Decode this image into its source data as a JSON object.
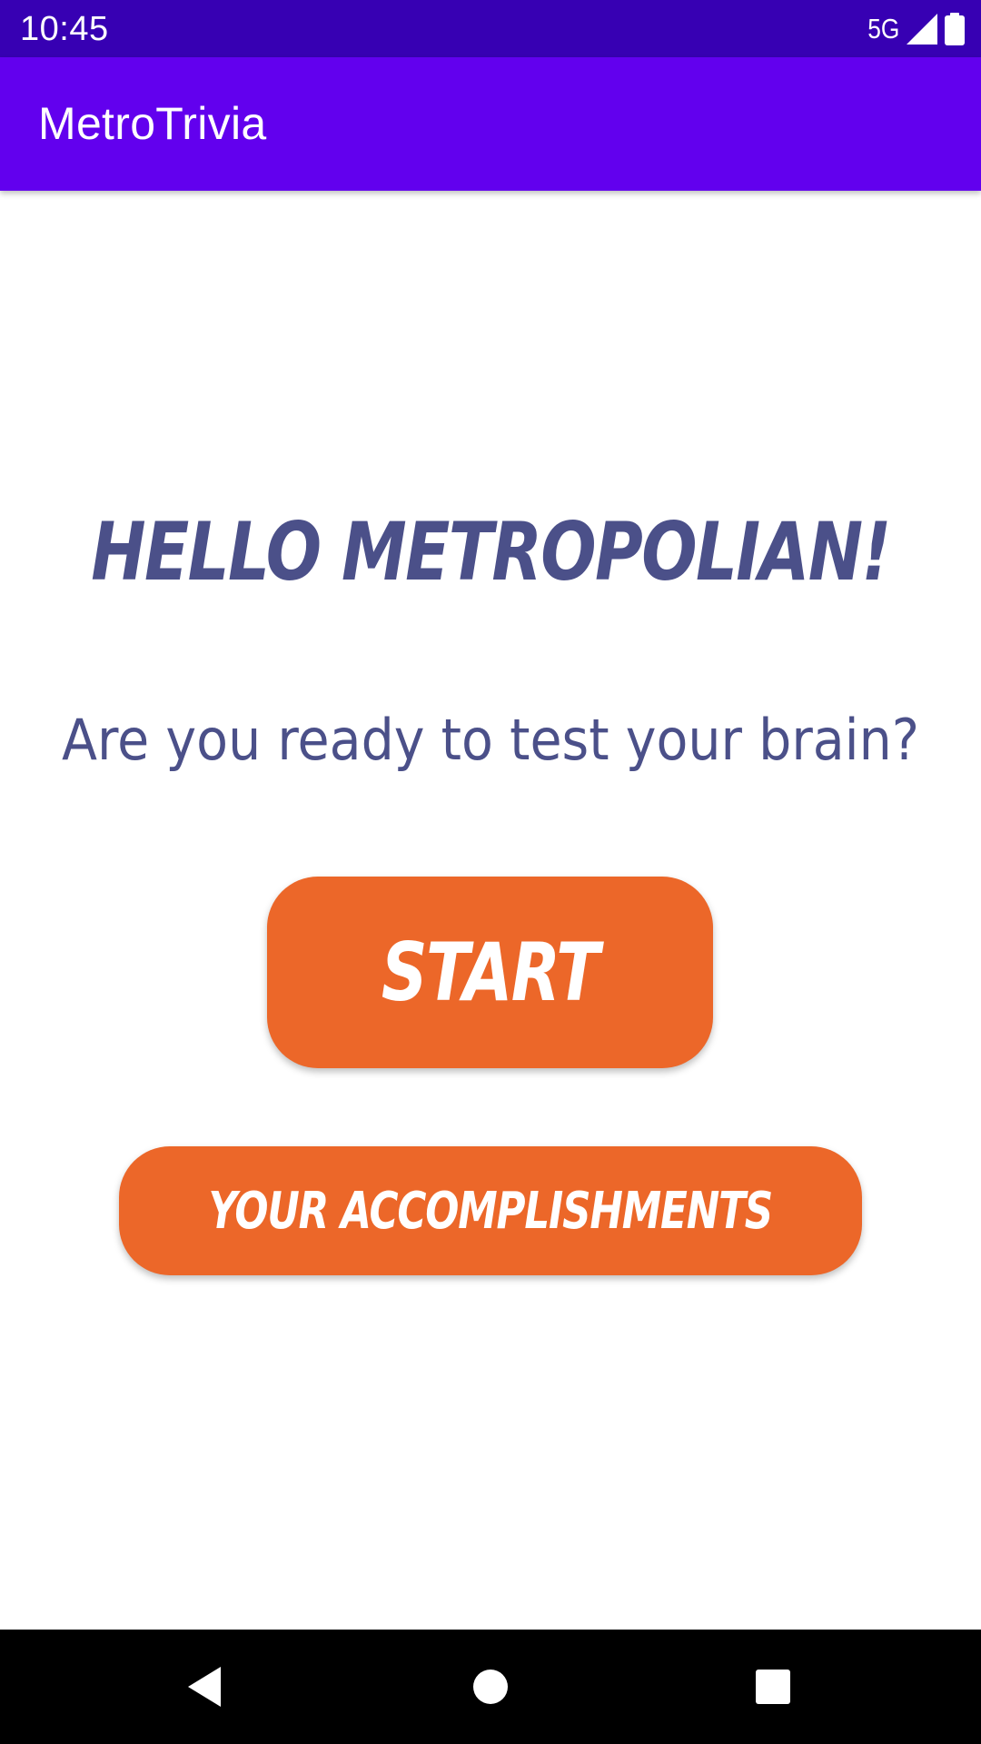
{
  "status_bar": {
    "time": "10:45",
    "network": "5G",
    "icons": [
      "signal-icon",
      "battery-icon"
    ]
  },
  "app_bar": {
    "title": "MetroTrivia",
    "color": "#6200ee"
  },
  "main": {
    "greeting": "HELLO METROPOLIAN!",
    "subtitle": "Are you ready to test your brain?",
    "start_label": "START",
    "accomplishments_label": "YOUR ACCOMPLISHMENTS"
  },
  "colors": {
    "status_bar": "#3700b3",
    "app_bar": "#6200ee",
    "text": "#4b5089",
    "button": "#ec6729",
    "nav_bar": "#000000"
  },
  "nav_bar": {
    "icons": [
      "back-icon",
      "home-icon",
      "recents-icon"
    ]
  }
}
